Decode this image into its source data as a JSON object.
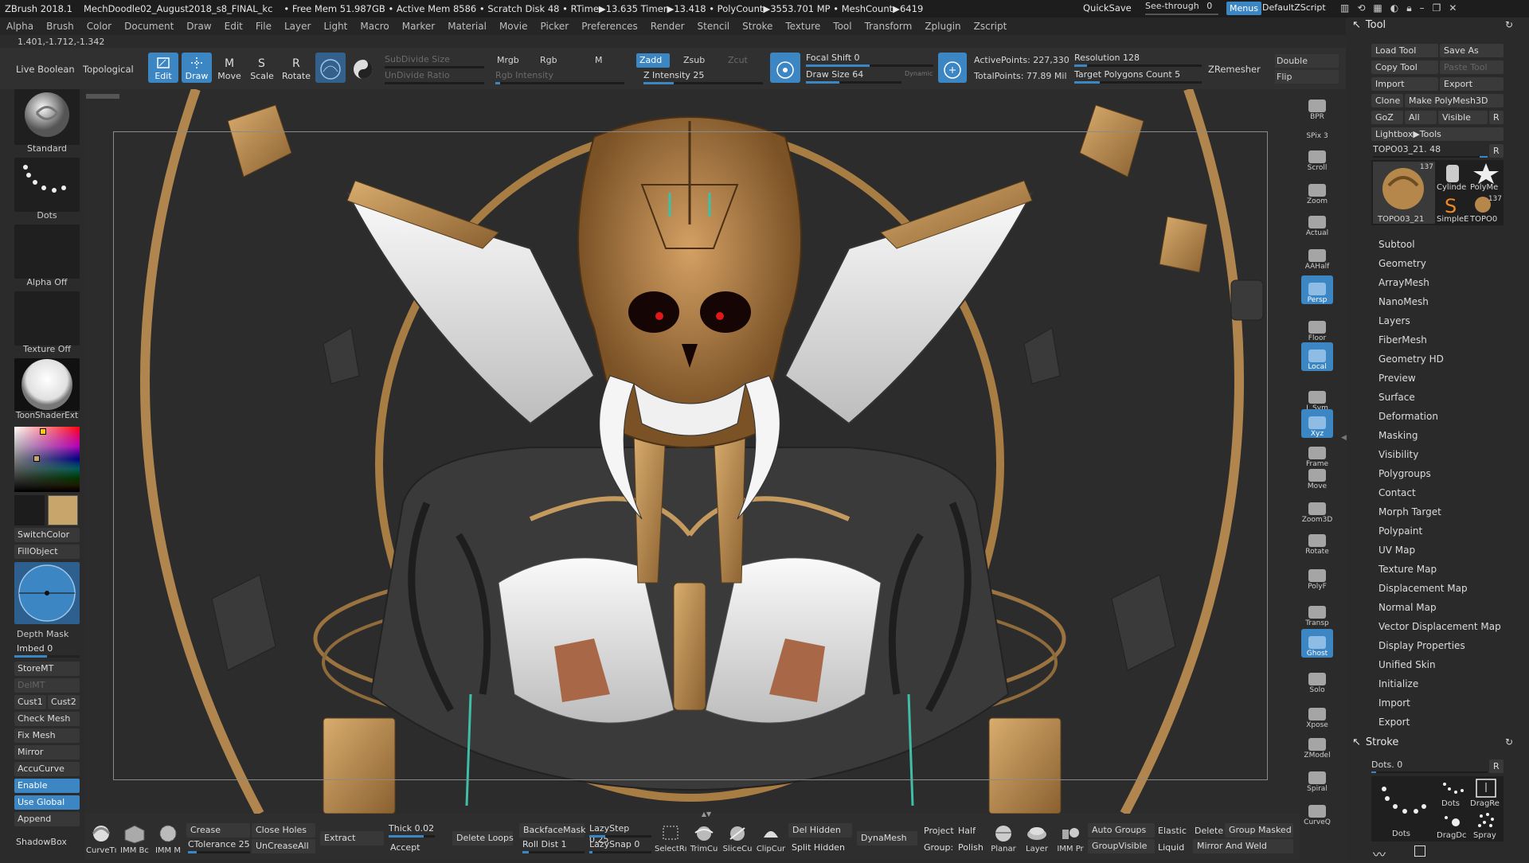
{
  "titlebar": {
    "app": "ZBrush 2018.1",
    "file": "MechDoodle02_August2018_s8_FINAL_kc",
    "stats": "• Free Mem 51.987GB • Active Mem 8586 • Scratch Disk 48 • RTime▶13.635 Timer▶13.418 • PolyCount▶3553.701 MP • MeshCount▶6419",
    "quicksave": "QuickSave",
    "seethrough": "See-through",
    "seethrough_value": "0",
    "menus": "Menus",
    "script": "DefaultZScript"
  },
  "menubar": [
    "Alpha",
    "Brush",
    "Color",
    "Document",
    "Draw",
    "Edit",
    "File",
    "Layer",
    "Light",
    "Macro",
    "Marker",
    "Material",
    "Movie",
    "Picker",
    "Preferences",
    "Render",
    "Stencil",
    "Stroke",
    "Texture",
    "Tool",
    "Transform",
    "Zplugin",
    "Zscript"
  ],
  "coords": "1.401,-1.712,-1.342",
  "toolbar": {
    "live_boolean": "Live Boolean",
    "topological": "Topological",
    "edit": "Edit",
    "draw": "Draw",
    "move": "Move",
    "scale": "Scale",
    "rotate": "Rotate",
    "subdivide_size": "SubDivide Size",
    "undivide_ratio": "UnDivide Ratio",
    "mrgb": "Mrgb",
    "rgb": "Rgb",
    "m": "M",
    "rgb_intensity": "Rgb Intensity",
    "zadd": "Zadd",
    "zsub": "Zsub",
    "zcut": "Zcut",
    "z_intensity": "Z Intensity 25",
    "focal_shift": "Focal Shift 0",
    "draw_size": "Draw Size 64",
    "dynamic": "Dynamic",
    "active_points": "ActivePoints: 227,330",
    "total_points": "TotalPoints: 77.89 Mil",
    "resolution": "Resolution 128",
    "target_polygons": "Target Polygons Count 5",
    "zremesher": "ZRemesher",
    "double": "Double",
    "flip": "Flip"
  },
  "left": {
    "brush": "Standard",
    "stroke": "Dots",
    "alpha": "Alpha Off",
    "texture": "Texture Off",
    "material": "ToonShaderExt",
    "switchcolor": "SwitchColor",
    "fillobject": "FillObject",
    "depth_mask": "Depth Mask",
    "imbed": "Imbed 0",
    "storemt": "StoreMT",
    "delmt": "DelMT",
    "cust1": "Cust1",
    "cust2": "Cust2",
    "check_mesh": "Check Mesh In",
    "fix_mesh": "Fix Mesh",
    "mirror": "Mirror",
    "accucurve": "AccuCurve",
    "enable": "Enable",
    "use_global": "Use Global",
    "append": "Append",
    "shadowbox": "ShadowBox"
  },
  "rightshelf": [
    {
      "label": "BPR",
      "icon": "bpr-icon",
      "active": false
    },
    {
      "label": "SPix 3",
      "icon": "spix-icon",
      "active": false
    },
    {
      "label": "Scroll",
      "icon": "scroll-icon",
      "active": false
    },
    {
      "label": "Zoom",
      "icon": "zoom-icon",
      "active": false
    },
    {
      "label": "Actual",
      "icon": "actual-icon",
      "active": false
    },
    {
      "label": "AAHalf",
      "icon": "aahalf-icon",
      "active": false
    },
    {
      "label": "Persp",
      "icon": "persp-icon",
      "active": true
    },
    {
      "label": "Floor",
      "icon": "floor-icon",
      "active": false
    },
    {
      "label": "Local",
      "icon": "local-icon",
      "active": true
    },
    {
      "label": "L.Sym",
      "icon": "lsym-icon",
      "active": false
    },
    {
      "label": "Xyz",
      "icon": "xyz-icon",
      "active": true
    },
    {
      "label": "Frame",
      "icon": "frame-icon",
      "active": false
    },
    {
      "label": "Move",
      "icon": "move-icon",
      "active": false
    },
    {
      "label": "Zoom3D",
      "icon": "zoom3d-icon",
      "active": false
    },
    {
      "label": "Rotate",
      "icon": "rotate-icon",
      "active": false
    },
    {
      "label": "PolyF",
      "icon": "polyf-icon",
      "active": false
    },
    {
      "label": "Transp",
      "icon": "transp-icon",
      "active": false
    },
    {
      "label": "Ghost",
      "icon": "ghost-icon",
      "active": true
    },
    {
      "label": "Solo",
      "icon": "solo-icon",
      "active": false
    },
    {
      "label": "Xpose",
      "icon": "xpose-icon",
      "active": false
    },
    {
      "label": "ZModel",
      "icon": "zmodel-icon",
      "active": false
    },
    {
      "label": "Spiral",
      "icon": "spiral-icon",
      "active": false
    },
    {
      "label": "CurveQ",
      "icon": "curveq-icon",
      "active": false
    }
  ],
  "tool_panel": {
    "title": "Tool",
    "load_tool": "Load Tool",
    "save_as": "Save As",
    "copy_tool": "Copy Tool",
    "paste_tool": "Paste Tool",
    "import": "Import",
    "export": "Export",
    "clone": "Clone",
    "make_polymesh": "Make PolyMesh3D",
    "goz": "GoZ",
    "all": "All",
    "visible": "Visible",
    "r": "R",
    "lightbox_tools": "Lightbox▶Tools",
    "current_tool": "TOPO03_21. 48",
    "tools": [
      {
        "name": "TOPO03_21",
        "count": "137"
      },
      {
        "name": "Cylinde",
        "count": ""
      },
      {
        "name": "PolyMe",
        "count": ""
      },
      {
        "name": "SimpleE",
        "count": ""
      },
      {
        "name": "TOPO0",
        "count": "137"
      }
    ],
    "subpalettes": [
      "Subtool",
      "Geometry",
      "ArrayMesh",
      "NanoMesh",
      "Layers",
      "FiberMesh",
      "Geometry HD",
      "Preview",
      "Surface",
      "Deformation",
      "Masking",
      "Visibility",
      "Polygroups",
      "Contact",
      "Morph Target",
      "Polypaint",
      "UV Map",
      "Texture Map",
      "Displacement Map",
      "Normal Map",
      "Vector Displacement Map",
      "Display Properties",
      "Unified Skin",
      "Initialize",
      "Import",
      "Export"
    ]
  },
  "stroke_panel": {
    "title": "Stroke",
    "dots_value": "Dots. 0",
    "r": "R",
    "items": [
      "Dots",
      "DragRe",
      "DragDc",
      "Spray"
    ]
  },
  "bottombar": {
    "curvetube": "CurveTı",
    "imm_bc": "IMM Bc",
    "imm_m": "IMM M",
    "crease": "Crease",
    "ctolerance": "CTolerance 25",
    "close_holes": "Close Holes",
    "uncreaseall": "UnCreaseAll",
    "extract": "Extract",
    "thick": "Thick 0.02",
    "accept": "Accept",
    "delete_loops": "Delete Loops",
    "backfacemask": "BackfaceMask",
    "roll_dist": "Roll Dist 1",
    "lazystep": "LazyStep 0.25",
    "lazysnap": "LazySnap 0",
    "selectrect": "SelectRı",
    "trimcurve": "TrimCu",
    "slicecurve": "SliceCu",
    "clipcurve": "ClipCur",
    "del_hidden": "Del Hidden",
    "split_hidden": "Split Hidden",
    "dynamesh": "DynaMesh",
    "project": "Project",
    "half": "Half",
    "group": "Group:",
    "polish": "Polish",
    "planar": "Planar",
    "layer": "Layer",
    "imm_pr": "IMM Pr",
    "auto_groups": "Auto Groups",
    "groupvisible": "GroupVisible",
    "elastic": "Elastic",
    "liquid": "Liquid",
    "delete": "Delete",
    "group_masked": "Group Masked",
    "mirror_and_weld": "Mirror And Weld"
  },
  "colors": {
    "accent": "#3d86c4",
    "secondary": "#c8a56a",
    "model_gold": "#b5874a",
    "model_white": "#e8e8e8"
  }
}
